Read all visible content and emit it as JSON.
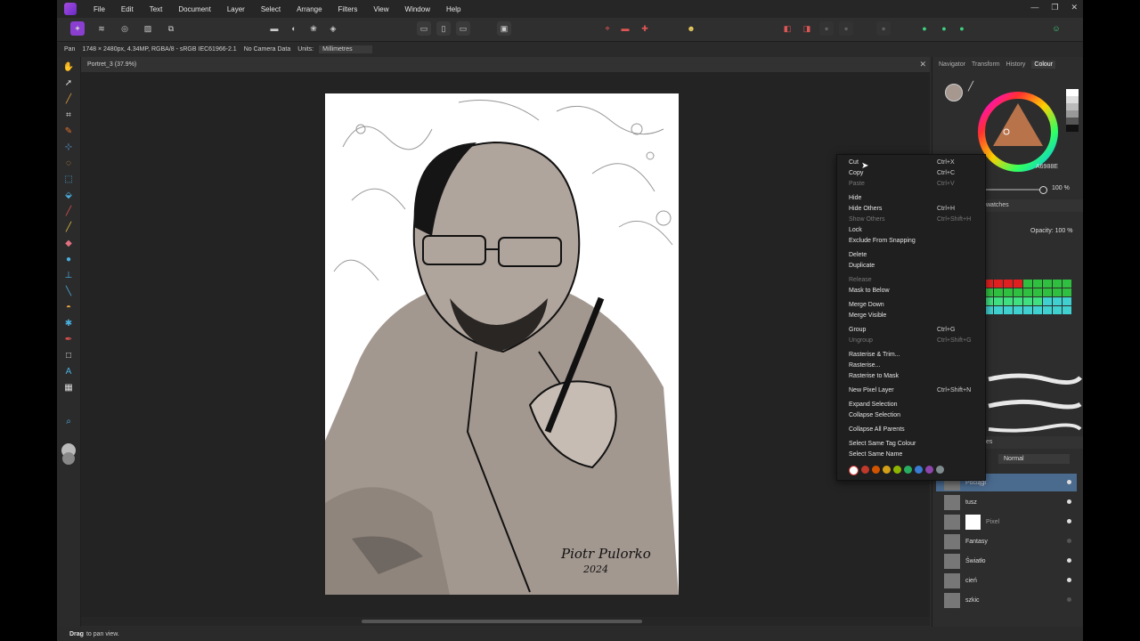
{
  "menu": [
    "File",
    "Edit",
    "Text",
    "Document",
    "Layer",
    "Select",
    "Arrange",
    "Filters",
    "View",
    "Window",
    "Help"
  ],
  "context_bar": {
    "tool": "Pan",
    "doc_info": "1748 × 2480px, 4.34MP, RGBA/8 - sRGB IEC61966-2.1",
    "camera": "No Camera Data",
    "units_label": "Units:",
    "units_value": "Millimetres"
  },
  "document_tab": "Portret_3 (37.9%)",
  "status_bar": {
    "bold": "Drag",
    "rest": "to pan view."
  },
  "panel": {
    "tabs": [
      "Navigator",
      "Transform",
      "History",
      "Colour"
    ],
    "active_tab": "Colour",
    "hex_value": "A6988E",
    "opacity_value": "100 %",
    "swatches_tab": "watches",
    "opacity_label": "Opacity:",
    "opacity2_value": "100 %",
    "blend_mode": "Normal",
    "layers_partial": "es"
  },
  "layers": [
    {
      "name": "Pociągi",
      "selected": true,
      "visible": true
    },
    {
      "name": "tusz",
      "selected": false,
      "visible": true
    },
    {
      "name": "Pixel",
      "selected": false,
      "visible": true,
      "child": true
    },
    {
      "name": "Fantasy",
      "selected": false,
      "visible": false
    },
    {
      "name": "Światło",
      "selected": false,
      "visible": true
    },
    {
      "name": "cień",
      "selected": false,
      "visible": true
    },
    {
      "name": "szkic",
      "selected": false,
      "visible": false
    }
  ],
  "context_menu": [
    {
      "label": "Cut",
      "shortcut": "Ctrl+X",
      "disabled": false
    },
    {
      "label": "Copy",
      "shortcut": "Ctrl+C",
      "disabled": false
    },
    {
      "label": "Paste",
      "shortcut": "Ctrl+V",
      "disabled": true
    },
    {
      "label": "Hide",
      "shortcut": "",
      "disabled": false
    },
    {
      "label": "Hide Others",
      "shortcut": "Ctrl+H",
      "disabled": false
    },
    {
      "label": "Show Others",
      "shortcut": "Ctrl+Shift+H",
      "disabled": true
    },
    {
      "label": "Lock",
      "shortcut": "",
      "disabled": false
    },
    {
      "label": "Exclude From Snapping",
      "shortcut": "",
      "disabled": false
    },
    {
      "label": "Delete",
      "shortcut": "",
      "disabled": false
    },
    {
      "label": "Duplicate",
      "shortcut": "",
      "disabled": false
    },
    {
      "label": "Release",
      "shortcut": "",
      "disabled": true
    },
    {
      "label": "Mask to Below",
      "shortcut": "",
      "disabled": false
    },
    {
      "label": "Merge Down",
      "shortcut": "",
      "disabled": false
    },
    {
      "label": "Merge Visible",
      "shortcut": "",
      "disabled": false
    },
    {
      "label": "Group",
      "shortcut": "Ctrl+G",
      "disabled": false
    },
    {
      "label": "Ungroup",
      "shortcut": "Ctrl+Shift+G",
      "disabled": true
    },
    {
      "label": "Rasterise & Trim...",
      "shortcut": "",
      "disabled": false
    },
    {
      "label": "Rasterise...",
      "shortcut": "",
      "disabled": false
    },
    {
      "label": "Rasterise to Mask",
      "shortcut": "",
      "disabled": false
    },
    {
      "label": "New Pixel Layer",
      "shortcut": "Ctrl+Shift+N",
      "disabled": false
    },
    {
      "label": "Expand Selection",
      "shortcut": "",
      "disabled": false
    },
    {
      "label": "Collapse Selection",
      "shortcut": "",
      "disabled": false
    },
    {
      "label": "Collapse All Parents",
      "shortcut": "",
      "disabled": false
    },
    {
      "label": "Select Same Tag Colour",
      "shortcut": "",
      "disabled": false
    },
    {
      "label": "Select Same Name",
      "shortcut": "",
      "disabled": false
    }
  ],
  "tag_colours": [
    "#ffffff",
    "#c0392b",
    "#d35400",
    "#d4a017",
    "#8db600",
    "#27ae60",
    "#3a7bd5",
    "#8e44ad",
    "#7f8c8d"
  ],
  "artwork": {
    "signature": "Piotr Pulorko",
    "year": "2024"
  }
}
